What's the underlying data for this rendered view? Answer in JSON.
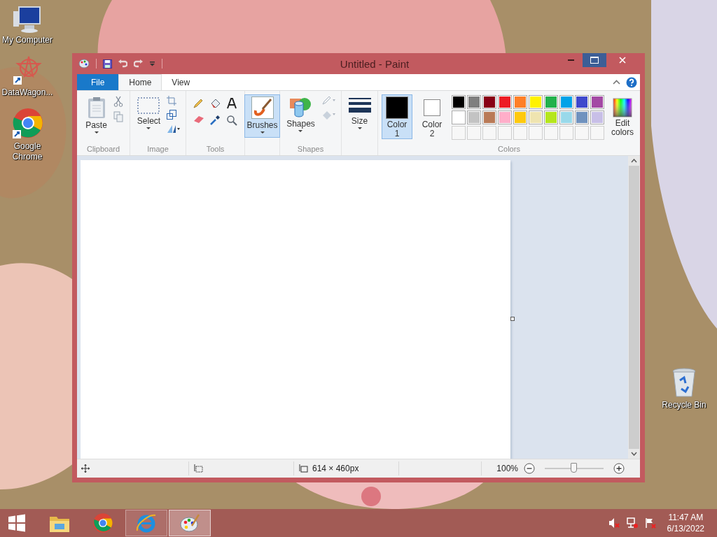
{
  "desktop_icons": [
    {
      "kind": "computer",
      "label": "My Computer"
    },
    {
      "kind": "app",
      "label": "DataWagon..."
    },
    {
      "kind": "chrome",
      "label": "Google Chrome"
    },
    {
      "kind": "recycle",
      "label": "Recycle Bin"
    }
  ],
  "window": {
    "title": "Untitled - Paint"
  },
  "tabs": [
    {
      "kind": "file",
      "label": "File",
      "selected": false
    },
    {
      "kind": "tab",
      "label": "Home",
      "selected": true
    },
    {
      "kind": "tab",
      "label": "View",
      "selected": false
    }
  ],
  "ribbon": {
    "clipboard": {
      "label": "Clipboard",
      "paste": "Paste"
    },
    "image": {
      "label": "Image",
      "select": "Select"
    },
    "tools": {
      "label": "Tools"
    },
    "brushes": {
      "label": "Brushes",
      "selected": true
    },
    "shapes": {
      "label": "Shapes",
      "button": "Shapes"
    },
    "size": {
      "label": "Size"
    },
    "colors": {
      "label": "Colors",
      "edit": "Edit colors",
      "active": [
        {
          "label": "Color 1",
          "color": "#000000",
          "selected": true
        },
        {
          "label": "Color 2",
          "color": "#ffffff",
          "selected": false
        }
      ],
      "palette": [
        {
          "color": "#000000"
        },
        {
          "color": "#7f7f7f"
        },
        {
          "color": "#880015"
        },
        {
          "color": "#ed1c24"
        },
        {
          "color": "#ff7f27"
        },
        {
          "color": "#fff200"
        },
        {
          "color": "#22b14c"
        },
        {
          "color": "#00a2e8"
        },
        {
          "color": "#3f48cc"
        },
        {
          "color": "#a349a4"
        },
        {
          "color": "#ffffff"
        },
        {
          "color": "#c3c3c3"
        },
        {
          "color": "#b97a57"
        },
        {
          "color": "#ffaec9"
        },
        {
          "color": "#ffc90e"
        },
        {
          "color": "#efe4b0"
        },
        {
          "color": "#b5e61d"
        },
        {
          "color": "#99d9ea"
        },
        {
          "color": "#7092be"
        },
        {
          "color": "#c8bfe7"
        }
      ]
    }
  },
  "status_bar": {
    "size": "614 × 460px",
    "zoom": "100%",
    "level": 0.5
  },
  "taskbar": {
    "apps": [
      {
        "kind": "explorer",
        "running": false,
        "selected": false
      },
      {
        "kind": "chrome",
        "running": false,
        "selected": false
      },
      {
        "kind": "ie",
        "running": true,
        "selected": false
      },
      {
        "kind": "paint",
        "running": true,
        "selected": true
      }
    ],
    "time": "11:47 AM",
    "date": "6/13/2022"
  }
}
